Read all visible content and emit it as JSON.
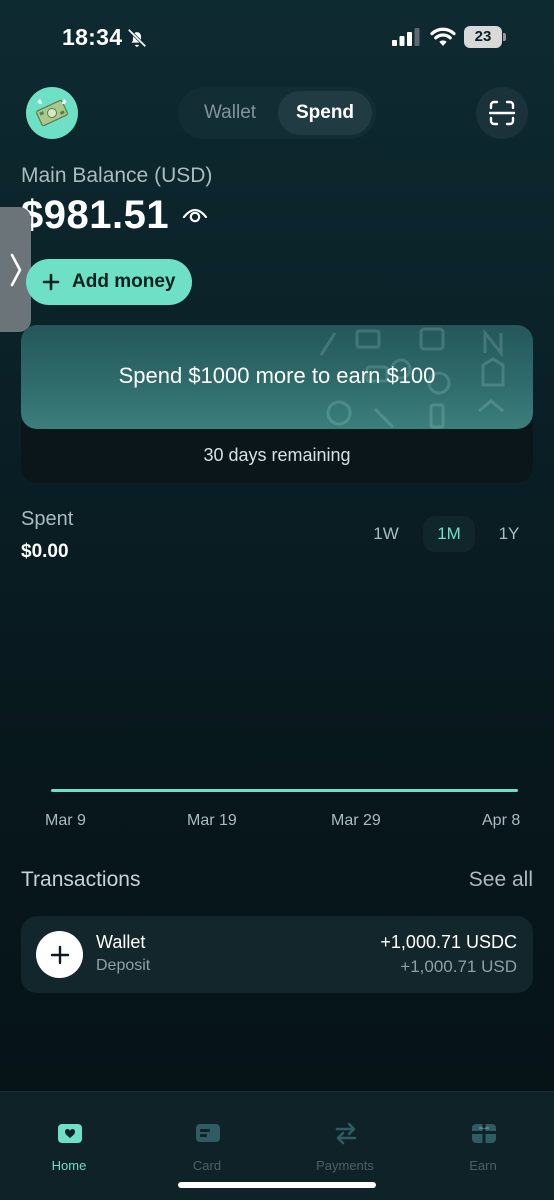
{
  "status_bar": {
    "time": "18:34",
    "battery": "23"
  },
  "header": {
    "avatar_icon": "money-emoji-icon",
    "segments": [
      {
        "label": "Wallet"
      },
      {
        "label": "Spend"
      }
    ],
    "active_segment": "Spend",
    "scan_icon": "scan-icon"
  },
  "balance": {
    "label": "Main Balance (USD)",
    "value": "$981.51"
  },
  "add_money": {
    "label": "Add money"
  },
  "promo": {
    "text": "Spend $1000 more to earn $100",
    "remaining": "30 days remaining"
  },
  "spent": {
    "label": "Spent",
    "value": "$0.00",
    "ranges": [
      "1W",
      "1M",
      "1Y"
    ],
    "selected_range": "1M",
    "x_ticks": [
      "Mar 9",
      "Mar 19",
      "Mar 29",
      "Apr 8"
    ]
  },
  "transactions": {
    "title": "Transactions",
    "see_all": "See all",
    "items": [
      {
        "name": "Wallet",
        "type": "Deposit",
        "amount_primary": "+1,000.71 USDC",
        "amount_secondary": "+1,000.71 USD"
      }
    ]
  },
  "tabbar": {
    "tabs": [
      {
        "label": "Home",
        "icon": "wallet-icon"
      },
      {
        "label": "Card",
        "icon": "card-icon"
      },
      {
        "label": "Payments",
        "icon": "transfer-icon"
      },
      {
        "label": "Earn",
        "icon": "gift-icon"
      }
    ],
    "active": "Home"
  },
  "colors": {
    "accent": "#6ee0c6",
    "background": "#081a1f",
    "card": "#13262c"
  }
}
